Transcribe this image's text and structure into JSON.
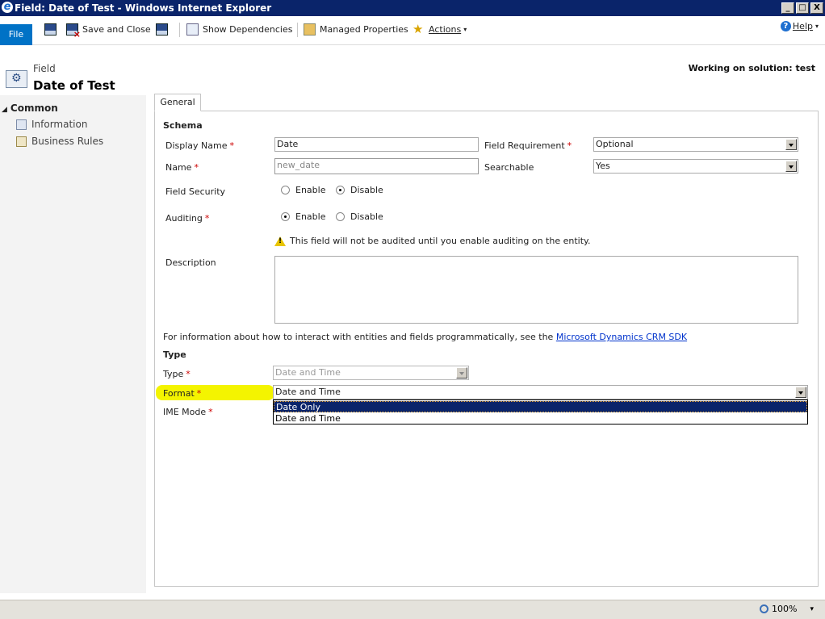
{
  "window": {
    "title": "Field: Date of Test - Windows Internet Explorer",
    "min": "_",
    "max": "□",
    "close": "X"
  },
  "ribbon": {
    "file": "File",
    "save_and_close": "Save and Close",
    "show_dependencies": "Show Dependencies",
    "managed_properties": "Managed Properties",
    "actions": "Actions",
    "actions_caret": "▾",
    "help": "Help",
    "help_caret": "▾",
    "help_icon_glyph": "?"
  },
  "header": {
    "entity_type": "Field",
    "entity_name": "Date of Test",
    "solution": "Working on solution: test"
  },
  "nav": {
    "group_toggle": "◢",
    "group": "Common",
    "items": [
      {
        "label": "Information",
        "icon": "document-icon"
      },
      {
        "label": "Business Rules",
        "icon": "rules-icon"
      }
    ]
  },
  "form": {
    "tab": "General",
    "required_mark": "*",
    "schema_section": "Schema",
    "display_name_label": "Display Name",
    "display_name_value": "Date",
    "field_requirement_label": "Field Requirement",
    "field_requirement_value": "Optional",
    "name_label": "Name",
    "name_value": "new_date",
    "searchable_label": "Searchable",
    "searchable_value": "Yes",
    "field_security_label": "Field Security",
    "field_security_enable": "Enable",
    "field_security_disable": "Disable",
    "field_security_selected": "Disable",
    "auditing_label": "Auditing",
    "auditing_enable": "Enable",
    "auditing_disable": "Disable",
    "auditing_selected": "Enable",
    "audit_warning": "This field will not be audited until you enable auditing on the entity.",
    "description_label": "Description",
    "description_value": "",
    "info_text": "For information about how to interact with entities and fields programmatically, see the",
    "sdk_link": "Microsoft Dynamics CRM SDK",
    "type_section": "Type",
    "type_label": "Type",
    "type_value": "Date and Time",
    "format_label": "Format",
    "format_value": "Date and Time",
    "format_options": [
      "Date Only",
      "Date and Time"
    ],
    "format_highlighted_option": "Date Only",
    "ime_mode_label": "IME Mode"
  },
  "status": {
    "zoom": "100%",
    "zoom_caret": "▾"
  },
  "colors": {
    "title_bar": "#0a246a",
    "file_tab": "#0072c6",
    "highlight": "#f4f400",
    "required": "#cc0000",
    "link": "#0033cc",
    "dropdown_selected": "#0a246a"
  }
}
